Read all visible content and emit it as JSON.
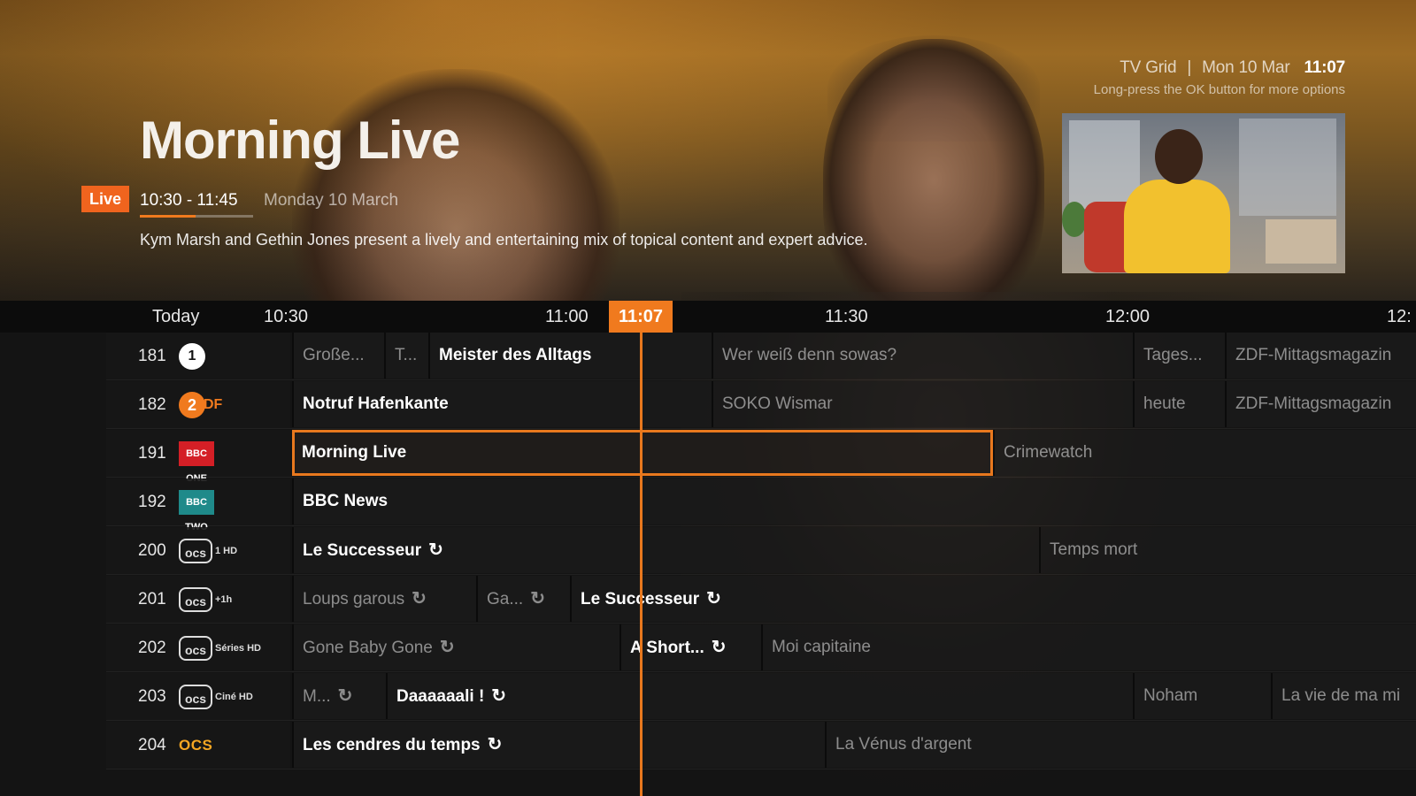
{
  "header": {
    "section": "TV Grid",
    "separator": "|",
    "date": "Mon 10 Mar",
    "clock": "11:07",
    "hint": "Long-press the OK button for more options"
  },
  "hero": {
    "title": "Morning Live",
    "live_badge": "Live",
    "time_range": "10:30 - 11:45",
    "progress_fraction": 0.49,
    "date_long": "Monday 10 March",
    "synopsis": "Kym Marsh and Gethin Jones present a lively and entertaining mix of topical content and expert advice."
  },
  "timeline": {
    "day": "Today",
    "ticks": [
      "10:30",
      "11:00",
      "11:30",
      "12:00",
      "12:"
    ],
    "now": "11:07"
  },
  "colors": {
    "accent": "#f07a1e",
    "live": "#f0641e",
    "zdf": "#f07a1e",
    "bbc_one": "#d41f26",
    "bbc_two": "#1f8a8a",
    "ocs": "#f5a623"
  },
  "channels": [
    {
      "number": "181",
      "logo": "das-erste-logo",
      "logo_text": "1",
      "programs": [
        {
          "title": "Große...",
          "state": "past"
        },
        {
          "title": "T...",
          "state": "past"
        },
        {
          "title": "Meister des Alltags",
          "state": "current"
        },
        {
          "title": "Wer weiß denn sowas?",
          "state": "future"
        },
        {
          "title": "Tages...",
          "state": "future"
        },
        {
          "title": "ZDF-Mittagsmagazin",
          "state": "future"
        }
      ]
    },
    {
      "number": "182",
      "logo": "zdf-logo",
      "logo_text": "2DF",
      "programs": [
        {
          "title": "Notruf Hafenkante",
          "state": "current"
        },
        {
          "title": "SOKO Wismar",
          "state": "future"
        },
        {
          "title": "heute",
          "state": "future"
        },
        {
          "title": "ZDF-Mittagsmagazin",
          "state": "future"
        }
      ]
    },
    {
      "number": "191",
      "logo": "bbc-one-logo",
      "logo_text": "BBC ONE",
      "programs": [
        {
          "title": "Morning Live",
          "state": "selected"
        },
        {
          "title": "Crimewatch",
          "state": "future"
        }
      ]
    },
    {
      "number": "192",
      "logo": "bbc-two-logo",
      "logo_text": "BBC TWO",
      "programs": [
        {
          "title": "BBC News",
          "state": "current"
        }
      ]
    },
    {
      "number": "200",
      "logo": "ocs-1-logo",
      "logo_text": "ocs",
      "logo_sub": "1 HD",
      "programs": [
        {
          "title": "Le Successeur",
          "state": "current",
          "replay": true
        },
        {
          "title": "Temps mort",
          "state": "future"
        }
      ]
    },
    {
      "number": "201",
      "logo": "ocs-1-plus-1h-logo",
      "logo_text": "ocs",
      "logo_sub": "+1h",
      "programs": [
        {
          "title": "Loups garous",
          "state": "past",
          "replay": true
        },
        {
          "title": "Ga...",
          "state": "past",
          "replay": true
        },
        {
          "title": "Le Successeur",
          "state": "current",
          "replay": true
        }
      ]
    },
    {
      "number": "202",
      "logo": "ocs-series-logo",
      "logo_text": "ocs",
      "logo_sub": "Séries HD",
      "programs": [
        {
          "title": "Gone Baby Gone",
          "state": "past",
          "replay": true
        },
        {
          "title": "A Short...",
          "state": "current",
          "replay": true
        },
        {
          "title": "Moi capitaine",
          "state": "future"
        }
      ]
    },
    {
      "number": "203",
      "logo": "ocs-cine-logo",
      "logo_text": "ocs",
      "logo_sub": "Ciné HD",
      "programs": [
        {
          "title": "M...",
          "state": "past",
          "replay": true
        },
        {
          "title": "Daaaaaali !",
          "state": "current",
          "replay": true
        },
        {
          "title": "Noham",
          "state": "future"
        },
        {
          "title": "La vie de ma mi",
          "state": "future"
        }
      ]
    },
    {
      "number": "204",
      "logo": "ocs-logo",
      "logo_text": "OCS",
      "programs": [
        {
          "title": "Les cendres du temps",
          "state": "current",
          "replay": true
        },
        {
          "title": "La Vénus d'argent",
          "state": "future"
        }
      ]
    }
  ],
  "replay_glyph": "↻"
}
